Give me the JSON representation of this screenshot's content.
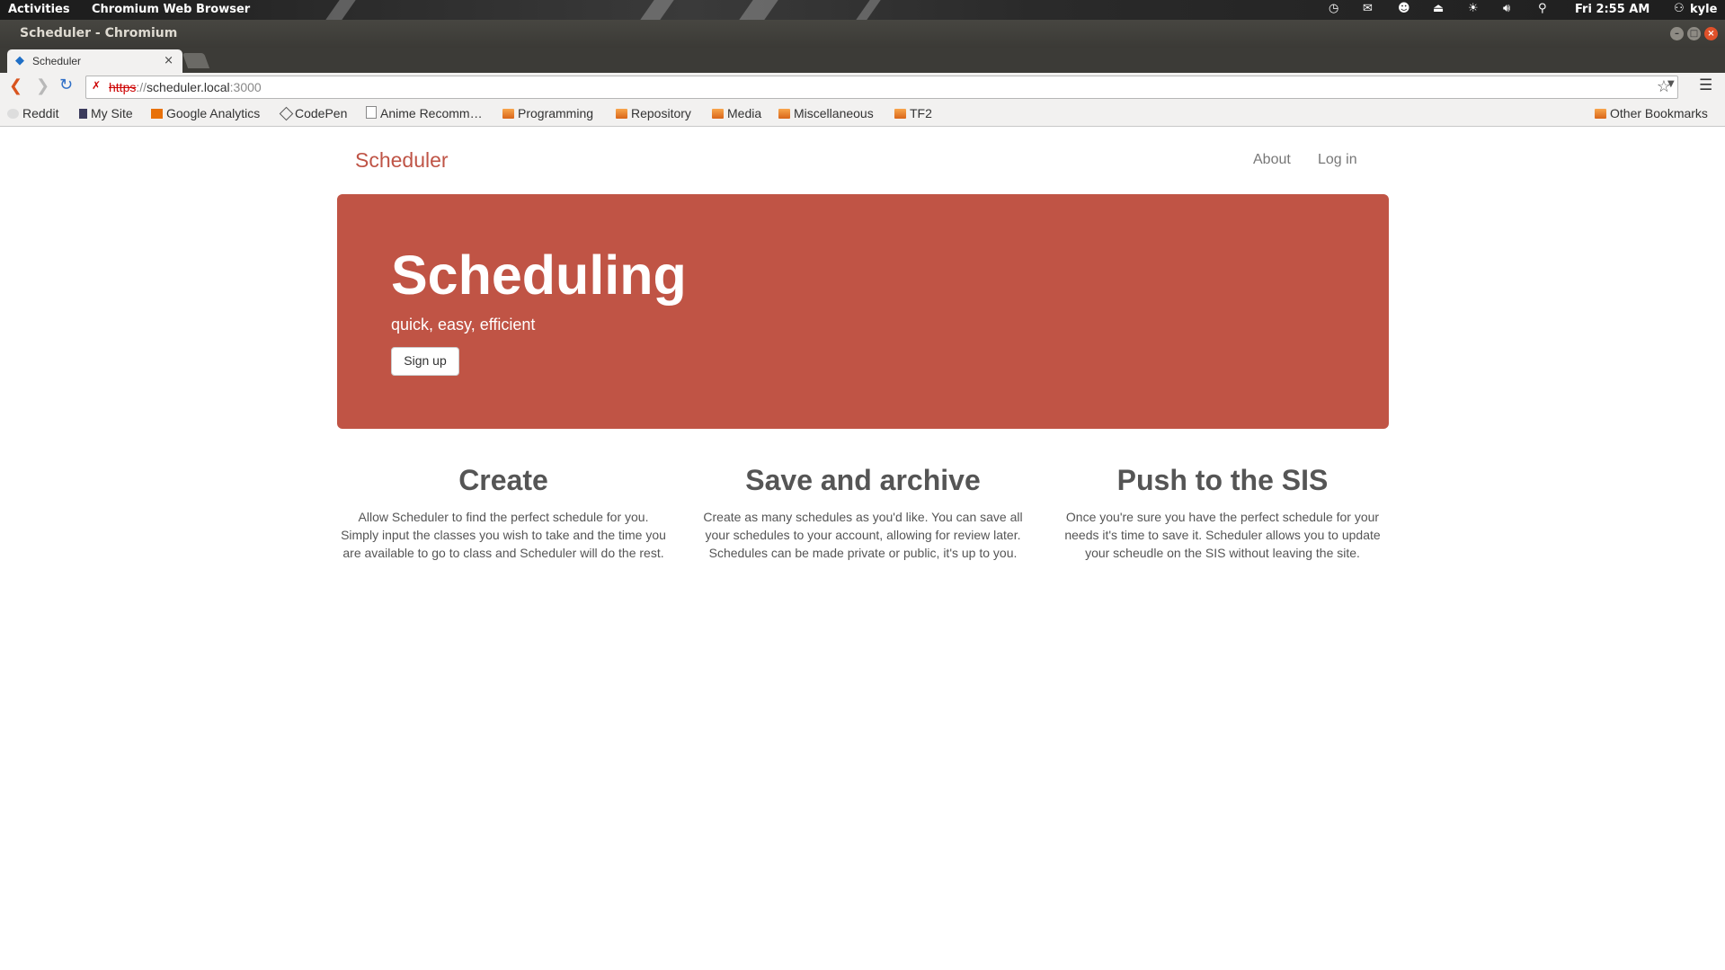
{
  "system_bar": {
    "activities": "Activities",
    "app_name": "Chromium Web Browser",
    "clock": "Fri  2:55 AM",
    "user": "kyle"
  },
  "window": {
    "title": "Scheduler - Chromium"
  },
  "browser": {
    "tab_title": "Scheduler",
    "tab_close": "×",
    "url_scheme": "https",
    "url_sep": "://",
    "url_host": "scheduler.local",
    "url_port": ":3000",
    "bookmarks": [
      "Reddit",
      "My Site",
      "Google Analytics",
      "CodePen",
      "Anime Recomm…",
      "Programming",
      "Repository",
      "Media",
      "Miscellaneous",
      "TF2"
    ],
    "other_bookmarks": "Other Bookmarks"
  },
  "site": {
    "brand": "Scheduler",
    "nav": [
      "About",
      "Log in"
    ],
    "hero": {
      "title": "Scheduling",
      "tagline": "quick, easy, efficient",
      "button": "Sign up"
    },
    "features": [
      {
        "title": "Create",
        "lines": [
          "Allow Scheduler to find the perfect schedule for you.",
          "Simply input the classes you wish to take and the time you",
          "are available to go to class and Scheduler will do the rest."
        ]
      },
      {
        "title": "Save and archive",
        "lines": [
          "Create as many schedules as you'd like. You can save all",
          "your schedules to your account, allowing for review later.",
          "Schedules can be made private or public, it's up to you."
        ]
      },
      {
        "title": "Push to the SIS",
        "lines": [
          "Once you're sure you have the perfect schedule for your",
          "needs it's time to save it. Scheduler allows you to update",
          "your scheudle on the SIS without leaving the site."
        ]
      }
    ]
  },
  "colors": {
    "brand": "#bf5446",
    "hero_bg": "#c05445"
  }
}
